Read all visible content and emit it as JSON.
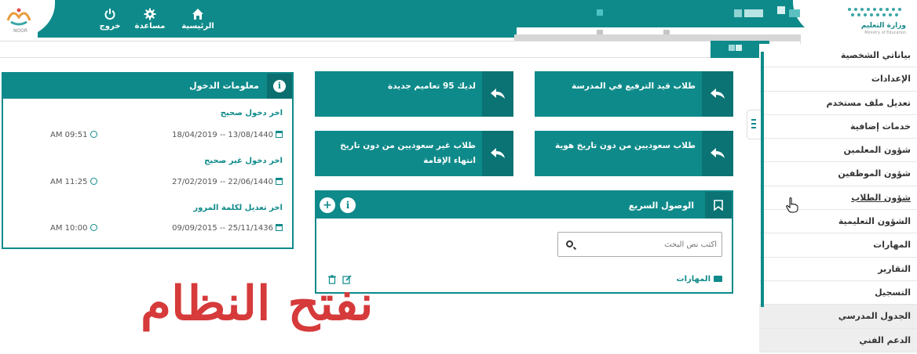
{
  "header": {
    "nav": [
      {
        "label": "الرئيسية",
        "icon": "home-icon"
      },
      {
        "label": "مساعدة",
        "icon": "gear-icon"
      },
      {
        "label": "خروج",
        "icon": "power-icon"
      }
    ],
    "left_logo_caption": "NOOR",
    "ministry_name": "وزارة التعليم",
    "ministry_sub": "Ministry of Education"
  },
  "sidebar": {
    "items": [
      {
        "label": "بياناتي الشخصية",
        "shaded": false
      },
      {
        "label": "الإعدادات",
        "shaded": false
      },
      {
        "label": "تعديل ملف مستخدم",
        "shaded": false
      },
      {
        "label": "خدمات إضافية",
        "shaded": false
      },
      {
        "label": "شؤون المعلمين",
        "shaded": false
      },
      {
        "label": "شؤون الموظفين",
        "shaded": false
      },
      {
        "label": "شؤون الطلاب",
        "shaded": false
      },
      {
        "label": "الشؤون التعليمية",
        "shaded": false
      },
      {
        "label": "المهارات",
        "shaded": false
      },
      {
        "label": "التقارير",
        "shaded": false
      },
      {
        "label": "التسجيل",
        "shaded": false
      },
      {
        "label": "الجدول المدرسي",
        "shaded": true
      },
      {
        "label": "الدعم الفني",
        "shaded": true
      }
    ]
  },
  "login_info": {
    "title": "معلومات الدخول",
    "entries": [
      {
        "label": "اخر دخول صحيح",
        "date": "18/04/2019 -- 13/08/1440",
        "time": "AM 09:51"
      },
      {
        "label": "اخر دخول غير صحيح",
        "date": "27/02/2019 -- 22/06/1440",
        "time": "AM 11:25"
      },
      {
        "label": "اخر تعديل لكلمة المرور",
        "date": "09/09/2015 -- 25/11/1436",
        "time": "AM 10:00"
      }
    ]
  },
  "cards": [
    {
      "text": "طلاب قيد الترفيع في المدرسة"
    },
    {
      "text": "لديك 95 تعاميم جديدة"
    },
    {
      "text": "طلاب سعوديين من دون تاريخ هوية"
    },
    {
      "text": "طلاب غير سعوديين من دون تاريخ انتهاء الإقامة"
    }
  ],
  "quick_access": {
    "title": "الوصول السريع",
    "search_placeholder": "اكتب نص البحث",
    "folder_label": "المهارات"
  },
  "overlay_caption": "نفتح النظام",
  "colors": {
    "primary": "#0f8a8a",
    "primary_dark": "#0b7373",
    "overlay": "#d63a3a"
  }
}
